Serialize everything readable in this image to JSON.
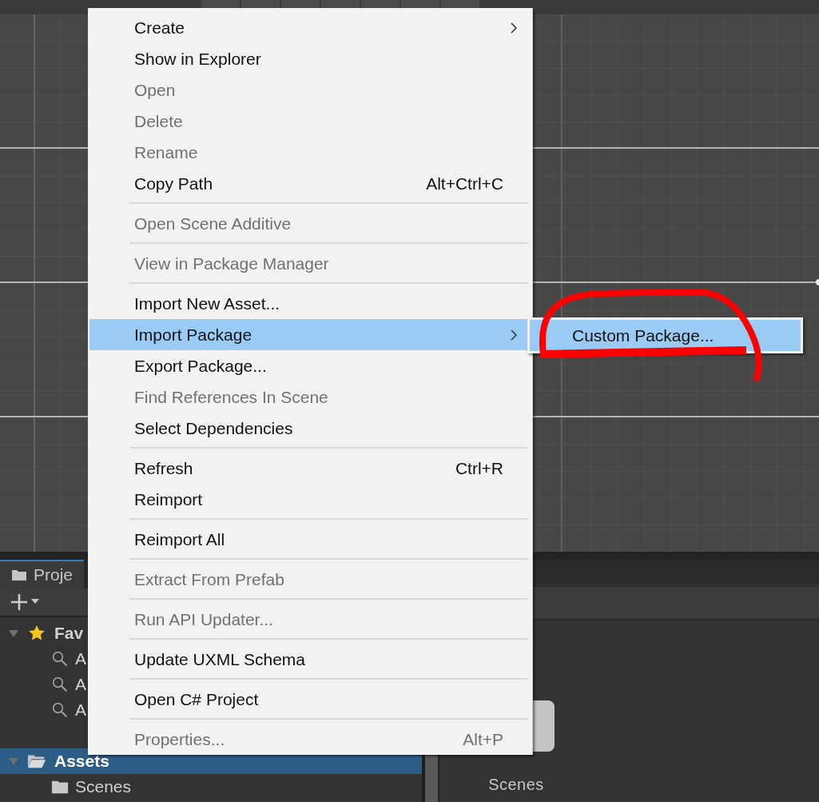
{
  "toolbar": {
    "buttons": [
      {
        "kind": "tool"
      },
      {
        "kind": "tool"
      },
      {
        "kind": "tool"
      },
      {
        "kind": "tool"
      },
      {
        "kind": "tool"
      },
      {
        "kind": "tool"
      },
      {
        "kind": "tool"
      }
    ]
  },
  "project_panel": {
    "tab": {
      "label": "Proje",
      "selected": true
    },
    "tree": [
      {
        "label": "Fav",
        "kind": "favorite",
        "expanded": true,
        "selected": false,
        "children": [
          {
            "label": "A",
            "kind": "search"
          },
          {
            "label": "A",
            "kind": "search"
          },
          {
            "label": "A",
            "kind": "search"
          }
        ]
      },
      {
        "label": "Assets",
        "kind": "folder",
        "expanded": true,
        "selected": true,
        "children": [
          {
            "label": "Scenes",
            "kind": "folder"
          }
        ]
      }
    ]
  },
  "asset_grid": {
    "items": [
      {
        "label": "Scenes"
      }
    ]
  },
  "context_menu": {
    "groups": [
      [
        {
          "label": "Create",
          "disabled": false,
          "submenu": true,
          "selected": false
        },
        {
          "label": "Show in Explorer",
          "disabled": false,
          "selected": false
        },
        {
          "label": "Open",
          "disabled": true,
          "selected": false
        },
        {
          "label": "Delete",
          "disabled": true,
          "selected": false
        },
        {
          "label": "Rename",
          "disabled": true,
          "selected": false
        },
        {
          "label": "Copy Path",
          "shortcut": "Alt+Ctrl+C",
          "disabled": false,
          "selected": false
        }
      ],
      [
        {
          "label": "Open Scene Additive",
          "disabled": true,
          "selected": false
        }
      ],
      [
        {
          "label": "View in Package Manager",
          "disabled": true,
          "selected": false
        }
      ],
      [
        {
          "label": "Import New Asset...",
          "disabled": false,
          "selected": false
        },
        {
          "label": "Import Package",
          "disabled": false,
          "submenu": true,
          "selected": true
        },
        {
          "label": "Export Package...",
          "disabled": false,
          "selected": false
        },
        {
          "label": "Find References In Scene",
          "disabled": true,
          "selected": false
        },
        {
          "label": "Select Dependencies",
          "disabled": false,
          "selected": false
        }
      ],
      [
        {
          "label": "Refresh",
          "shortcut": "Ctrl+R",
          "disabled": false,
          "selected": false
        },
        {
          "label": "Reimport",
          "disabled": false,
          "selected": false
        }
      ],
      [
        {
          "label": "Reimport All",
          "disabled": false,
          "selected": false
        }
      ],
      [
        {
          "label": "Extract From Prefab",
          "disabled": true,
          "selected": false
        }
      ],
      [
        {
          "label": "Run API Updater...",
          "disabled": true,
          "selected": false
        }
      ],
      [
        {
          "label": "Update UXML Schema",
          "disabled": false,
          "selected": false
        }
      ],
      [
        {
          "label": "Open C# Project",
          "disabled": false,
          "selected": false
        }
      ],
      [
        {
          "label": "Properties...",
          "shortcut": "Alt+P",
          "disabled": true,
          "selected": false
        }
      ]
    ]
  },
  "submenu": {
    "items": [
      {
        "label": "Custom Package...",
        "selected": true
      }
    ]
  },
  "annotation": {
    "kind": "scribble",
    "color": "#ff0000"
  }
}
